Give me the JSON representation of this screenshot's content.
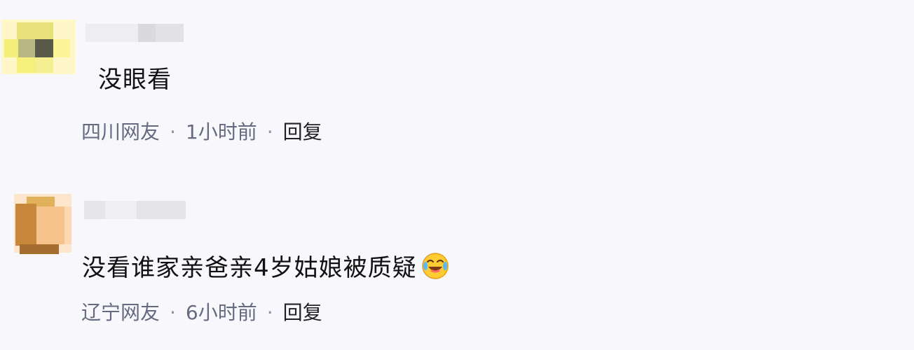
{
  "comments": [
    {
      "text": "没眼看",
      "location": "四川网友",
      "time": "1小时前",
      "reply_label": "回复",
      "separator": "·"
    },
    {
      "text": "没看谁家亲爸亲4岁姑娘被质疑",
      "emoji_icon": "laughing-tears-icon",
      "location": "辽宁网友",
      "time": "6小时前",
      "reply_label": "回复",
      "separator": "·"
    }
  ],
  "colors": {
    "background": "#f8f8fc",
    "meta_text": "#666a80",
    "reply_text": "#222222"
  }
}
